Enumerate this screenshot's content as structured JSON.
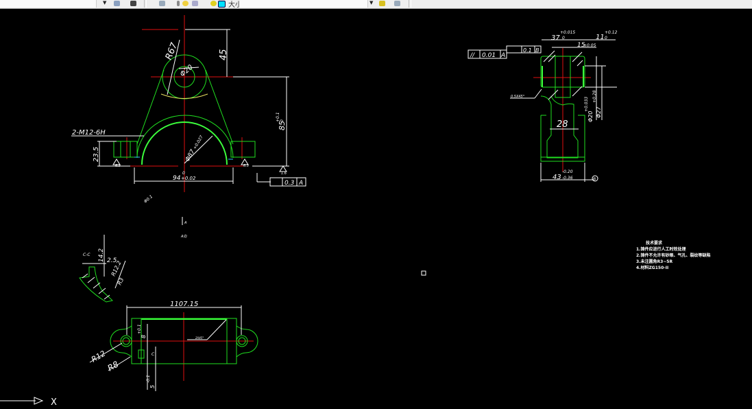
{
  "toolbar": {
    "layer_combo_value": "",
    "text_style_label": "大小",
    "icons": [
      "layer-states-icon",
      "layer-previous-icon",
      "layer-icon",
      "bulb-icon",
      "sun-icon",
      "lock-icon",
      "color-icon",
      "layer-match-icon",
      "layer-walk-icon"
    ]
  },
  "front_view": {
    "dim_radius": "R67",
    "dim_bore": "Φ20",
    "dim_height_top": "45",
    "dim_height": "85",
    "dim_height_tol_upper": "+0.1",
    "dim_height_tol_lower": "0",
    "dim_thread": "2-M12-6H",
    "dim_lug": "23.5",
    "dim_arch": "Φ87",
    "dim_arch_tol": "+0.027",
    "dim_width": "94",
    "dim_width_tol": "+0.02",
    "dim_width_tol_lower": "0",
    "roughness_left": "6.3",
    "roughness_right": "6.3",
    "roughness_base": "1.6",
    "tolerance_value": "0.3",
    "tolerance_datum": "A",
    "note_small": "Φ0.1",
    "view_label": "A",
    "view_label2": "A向"
  },
  "side_view": {
    "dim_37": "37",
    "dim_37_tol_upper": "+0.015",
    "dim_37_tol_lower": "0",
    "dim_11": "11",
    "dim_11_tol_upper": "+0.12",
    "dim_11_tol_lower": "0",
    "dim_15": "15",
    "dim_15_tol": "±0.05",
    "parallel_value": "0.01",
    "parallel_datum": "A",
    "perp_value": "0.1",
    "perp_datum": "B",
    "chamfer": "0.5X45°",
    "dim_28": "28",
    "dim_bore_20": "Φ20",
    "dim_bore_20_tol": "+0.033",
    "dim_bore_27": "Φ27",
    "dim_bore_27_tol": "+0.28",
    "dim_43": "43",
    "dim_43_tol_upper": "-0.20",
    "dim_43_tol_lower": "-0.36",
    "datum_b": "B"
  },
  "section_view": {
    "label": "C-C",
    "dim_142": "14.2",
    "dim_25": "2.5",
    "dim_r": "R12.2",
    "dim_r3": "R3"
  },
  "bottom_view": {
    "dim_length": "1107.15",
    "dim_r12": "R12",
    "dim_r8": "R8",
    "dim_8": "8",
    "dim_8_tol": "+0.1",
    "dim_5": "5",
    "dim_5_tol": "-0.1",
    "chamfer": "2X45°",
    "label_c": "C"
  },
  "tech_requirements": {
    "title": "技术要求",
    "items": [
      "1.铸件应进行人工时效处理",
      "2.铸件不允许有砂眼、气孔、裂纹等缺陷",
      "3.未注圆角R3~5R",
      "4.材料ZG150-II"
    ]
  },
  "ucs": {
    "x_label": "X"
  }
}
